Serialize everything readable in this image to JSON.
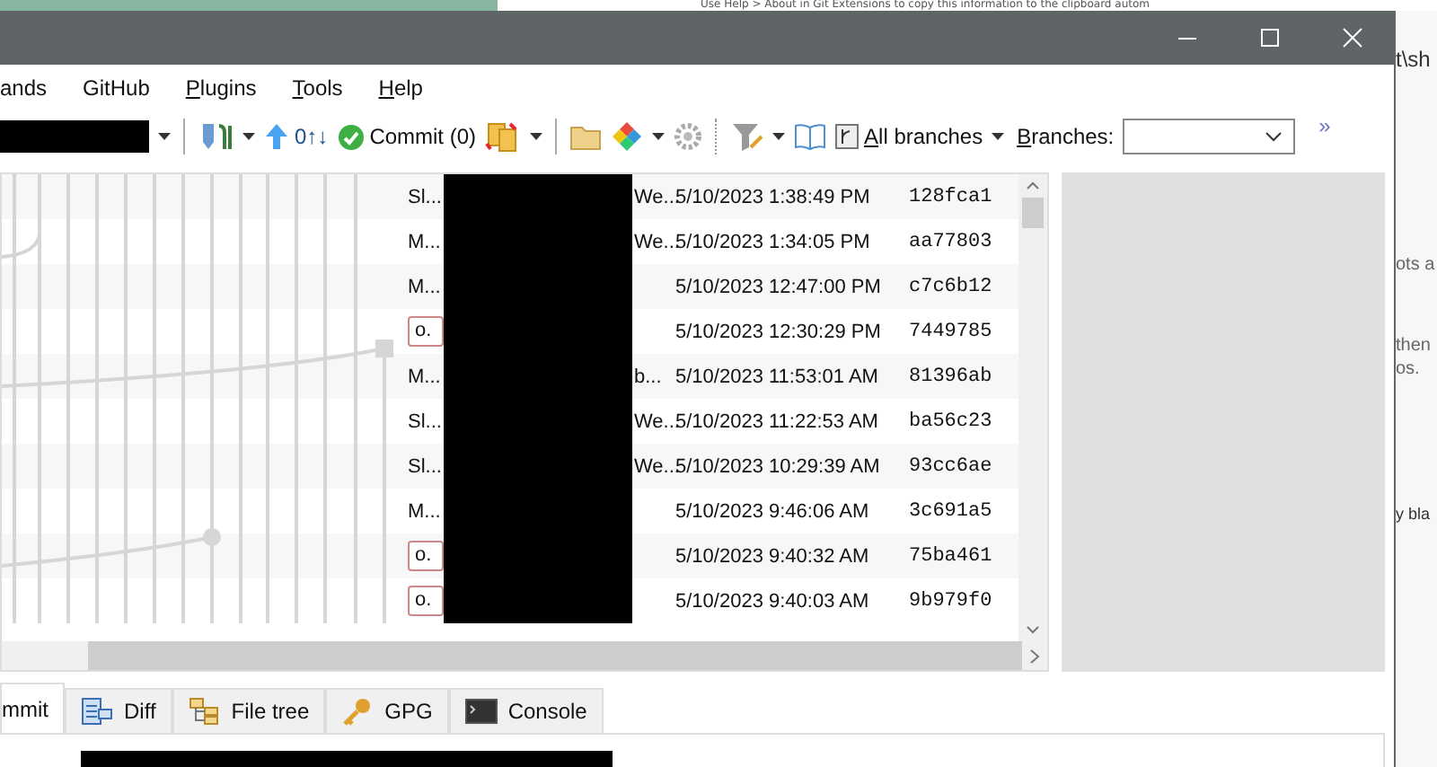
{
  "background_page": {
    "top_text": "Use Help > About in Git Extensions to copy this information to the clipboard autom",
    "side_fragments": [
      "t\\sh",
      "ots a",
      "then",
      "os.",
      "y bla"
    ]
  },
  "menu": [
    {
      "label": "ands",
      "access_key": false
    },
    {
      "label": "GitHub",
      "access_key": false
    },
    {
      "label": "Plugins",
      "access_key": true
    },
    {
      "label": "Tools",
      "access_key": true
    },
    {
      "label": "Help",
      "access_key": true
    }
  ],
  "toolbar": {
    "push_count": "0↑↓",
    "commit": "Commit (0)",
    "all_branches": "All branches",
    "branches_label": "Branches:",
    "overflow": "»"
  },
  "revisions": [
    {
      "message": "Sl...",
      "kind": "text",
      "author": "We...",
      "date": "5/10/2023 1:38:49 PM",
      "hash": "128fca1"
    },
    {
      "message": "M...",
      "kind": "text",
      "author": "We...",
      "date": "5/10/2023 1:34:05 PM",
      "hash": "aa77803"
    },
    {
      "message": "M...",
      "kind": "text",
      "date": "5/10/2023 12:47:00 PM",
      "hash": "c7c6b12"
    },
    {
      "message": "o.",
      "kind": "tag",
      "date": "5/10/2023 12:30:29 PM",
      "hash": "7449785"
    },
    {
      "message": "M...",
      "kind": "text",
      "author": "b...",
      "date": "5/10/2023 11:53:01 AM",
      "hash": "81396ab"
    },
    {
      "message": "Sl...",
      "kind": "text",
      "author": "We...",
      "date": "5/10/2023 11:22:53 AM",
      "hash": "ba56c23"
    },
    {
      "message": "Sl...",
      "kind": "text",
      "author": "We...",
      "date": "5/10/2023 10:29:39 AM",
      "hash": "93cc6ae"
    },
    {
      "message": "M...",
      "kind": "text",
      "date": "5/10/2023 9:46:06 AM",
      "hash": "3c691a5"
    },
    {
      "message": "o.",
      "kind": "tag",
      "date": "5/10/2023 9:40:32 AM",
      "hash": "75ba461"
    },
    {
      "message": "o.",
      "kind": "tag",
      "date": "5/10/2023 9:40:03 AM",
      "hash": "9b979f0"
    }
  ],
  "tabs": [
    {
      "label": "mmit",
      "selected": true
    },
    {
      "label": "Diff",
      "selected": false
    },
    {
      "label": "File tree",
      "selected": false
    },
    {
      "label": "GPG",
      "selected": false
    },
    {
      "label": "Console",
      "selected": false
    }
  ]
}
